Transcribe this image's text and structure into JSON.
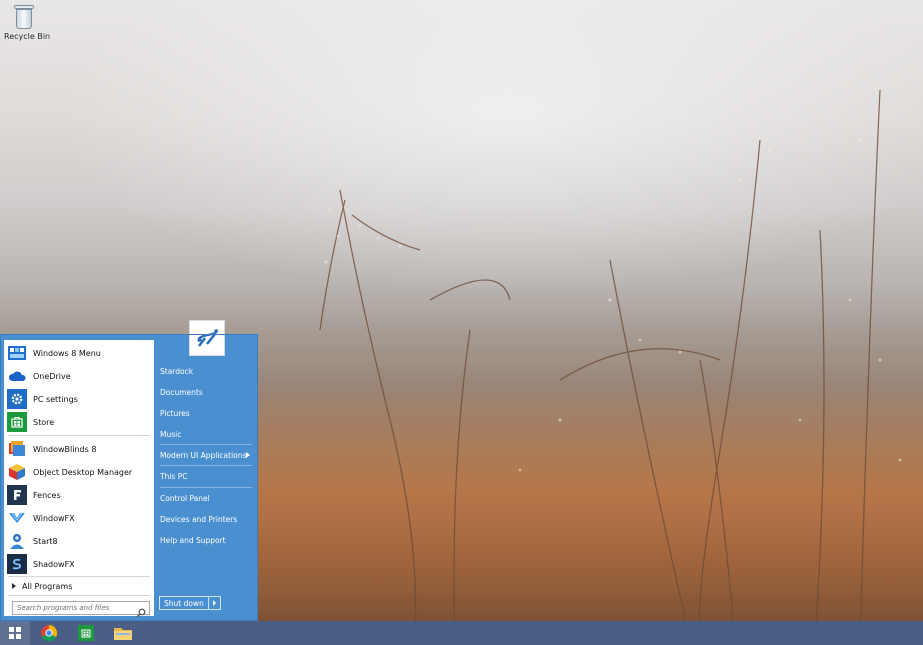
{
  "desktop": {
    "recycle_bin_label": "Recycle Bin"
  },
  "start_menu": {
    "programs": [
      {
        "label": "Windows 8 Menu",
        "icon": "windows8-menu-icon"
      },
      {
        "label": "OneDrive",
        "icon": "onedrive-cloud-icon"
      },
      {
        "label": "PC settings",
        "icon": "gear-icon"
      },
      {
        "label": "Store",
        "icon": "store-bag-icon"
      },
      {
        "label": "WindowBlinds 8",
        "icon": "windowblinds-icon"
      },
      {
        "label": "Object Desktop Manager",
        "icon": "object-desktop-cube-icon"
      },
      {
        "label": "Fences",
        "icon": "fences-icon"
      },
      {
        "label": "WindowFX",
        "icon": "windowfx-icon"
      },
      {
        "label": "Start8",
        "icon": "start8-icon"
      },
      {
        "label": "ShadowFX",
        "icon": "shadowfx-icon"
      }
    ],
    "all_programs_label": "All Programs",
    "search_placeholder": "Search programs and files",
    "right_items": [
      "Stardock",
      "Documents",
      "Pictures",
      "Music",
      "Modern UI Applications",
      "This PC",
      "Control Panel",
      "Devices and Printers",
      "Help and Support"
    ],
    "shutdown_label": "Shut down"
  },
  "taskbar": {
    "pinned": [
      "start-button-icon",
      "chrome-icon",
      "store-icon",
      "file-explorer-icon"
    ]
  },
  "colors": {
    "start_menu_blue": "#4a8fd0",
    "taskbar": "#46608c"
  }
}
